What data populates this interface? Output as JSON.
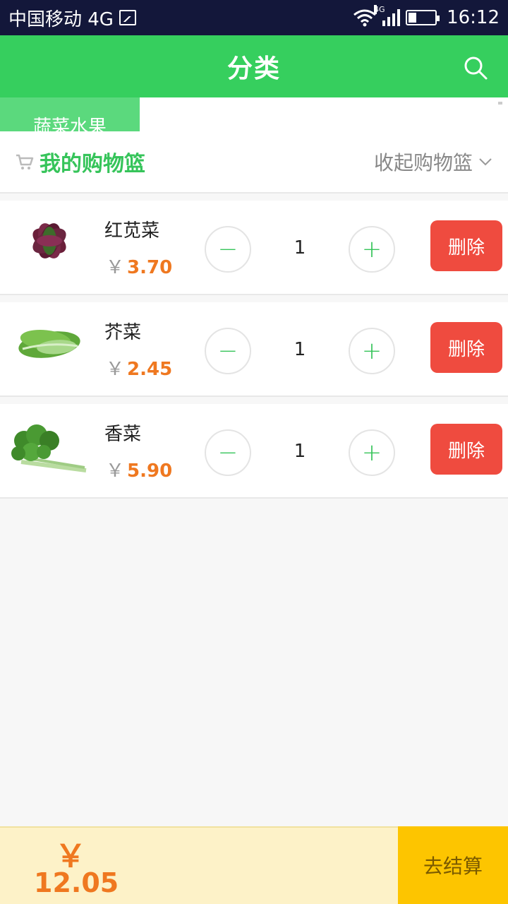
{
  "status_bar": {
    "carrier": "中国移动 4G",
    "network_tag": "4G",
    "time": "16:12",
    "battery_level": 0.3
  },
  "app_bar": {
    "title": "分类",
    "search_icon": "search-icon"
  },
  "category_tab": {
    "label": "蔬菜水果"
  },
  "basket": {
    "title": "我的购物篮",
    "collapse_label": "收起购物篮",
    "cart_icon": "cart-icon",
    "chevron_icon": "chevron-down-icon"
  },
  "items": [
    {
      "name": "红苋菜",
      "currency": "￥",
      "price": "3.70",
      "qty": "1",
      "delete_label": "删除",
      "minus": "−",
      "plus": "+"
    },
    {
      "name": "芥菜",
      "currency": "￥",
      "price": "2.45",
      "qty": "1",
      "delete_label": "删除",
      "minus": "−",
      "plus": "+"
    },
    {
      "name": "香菜",
      "currency": "￥",
      "price": "5.90",
      "qty": "1",
      "delete_label": "删除",
      "minus": "−",
      "plus": "+"
    }
  ],
  "footer": {
    "currency": "￥",
    "total": "12.05",
    "checkout_label": "去结算"
  },
  "colors": {
    "brand_green": "#36cf5e",
    "price_orange": "#ef7820",
    "delete_red": "#ef4b3f",
    "checkout_yellow": "#fdc500"
  }
}
